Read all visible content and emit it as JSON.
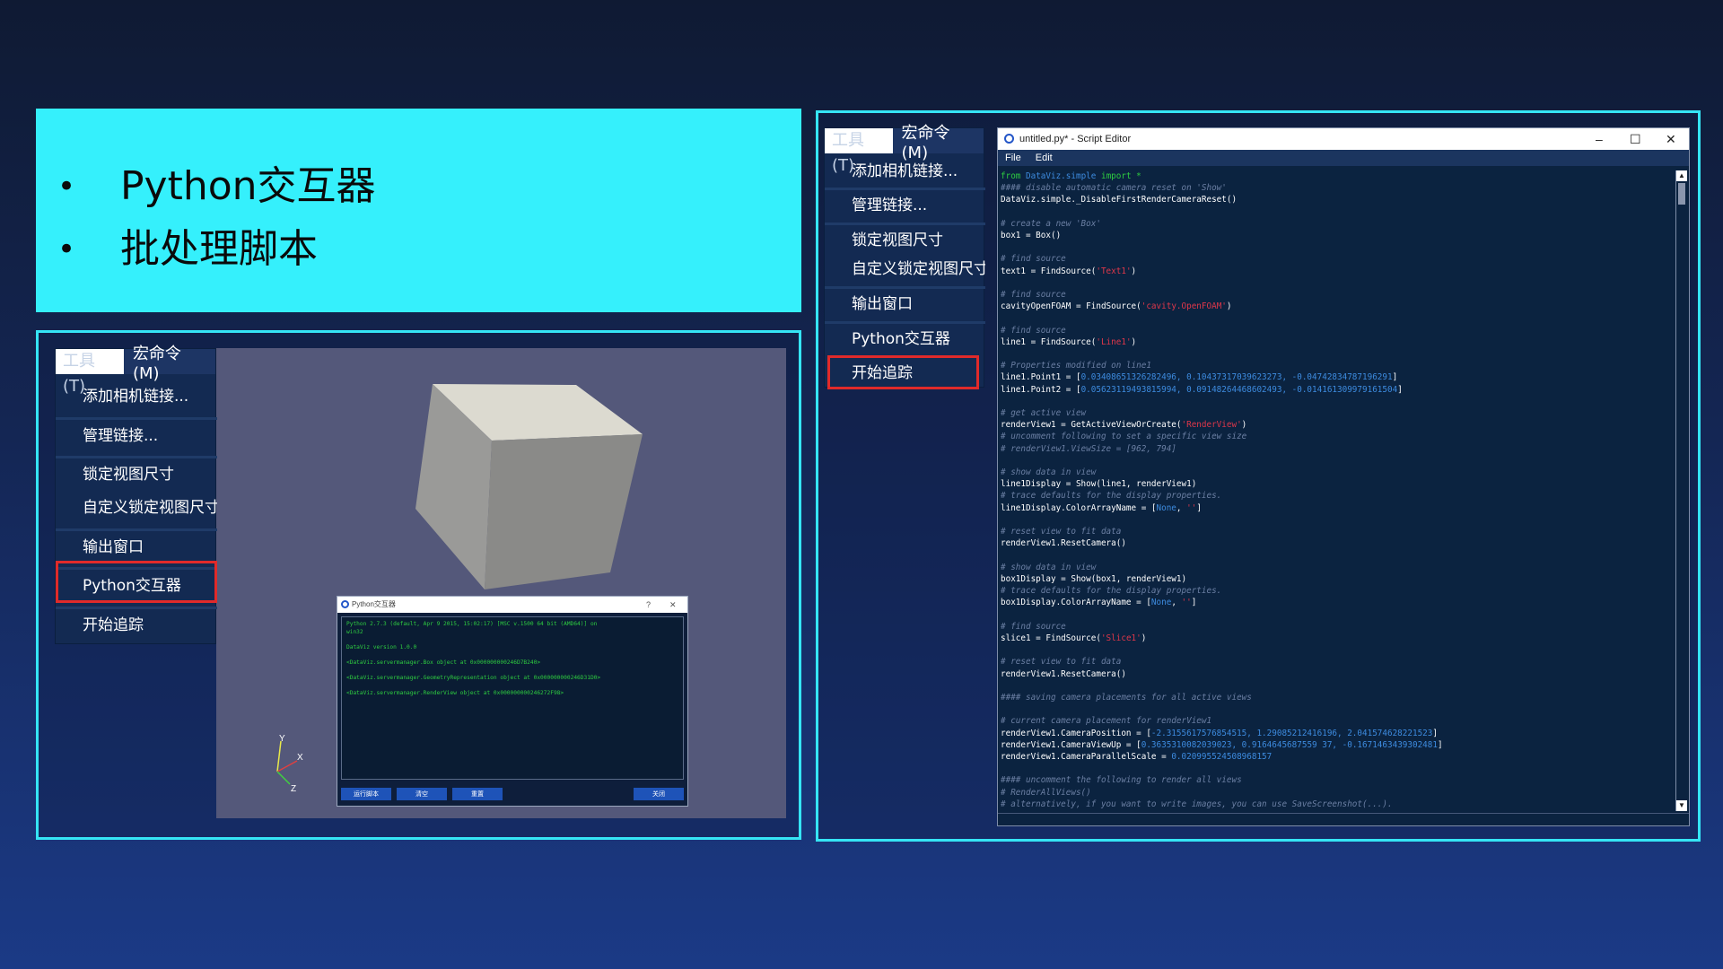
{
  "slide": {
    "bullets": [
      "Python交互器",
      "批处理脚本"
    ]
  },
  "left_menu": {
    "tabs": [
      "工具(T)",
      "宏命令(M)"
    ],
    "items": [
      "添加相机链接...",
      "管理链接...",
      "锁定视图尺寸",
      "自定义锁定视图尺寸",
      "输出窗口",
      "Python交互器",
      "开始追踪"
    ]
  },
  "right_menu": {
    "tabs": [
      "工具(T)",
      "宏命令(M)"
    ],
    "items": [
      "添加相机链接...",
      "管理链接...",
      "锁定视图尺寸",
      "自定义锁定视图尺寸",
      "输出窗口",
      "Python交互器",
      "开始追踪"
    ]
  },
  "axes": {
    "y": "Y",
    "x": "X",
    "z": "Z"
  },
  "python_dialog": {
    "title": "Python交互器",
    "help": "?",
    "close": "✕",
    "console_lines": [
      "Python 2.7.3 (default, Apr  9 2015, 15:02:17) [MSC v.1500 64 bit (AMD64)] on",
      "win32",
      "",
      "DataViz version 1.0.0",
      "",
      "<DataViz.servermanager.Box object at 0x000000000246D7B240>",
      "",
      "<DataViz.servermanager.GeometryRepresentation object at 0x000000000246D31D0>",
      "",
      "<DataViz.servermanager.RenderView object at 0x000000000246272F98>",
      ""
    ],
    "buttons": {
      "run": "运行脚本",
      "clear": "清空",
      "reset": "重置",
      "close": "关闭"
    }
  },
  "editor": {
    "title": "untitled.py* - Script Editor",
    "menu": [
      "File",
      "Edit"
    ],
    "window_controls": [
      "–",
      "☐",
      "✕"
    ],
    "code_lines": [
      [
        [
          "kw",
          "from "
        ],
        [
          "n",
          "DataViz.simple"
        ],
        [
          "kw",
          " import *"
        ]
      ],
      [
        [
          "c",
          "#### disable automatic camera reset on 'Show'"
        ]
      ],
      [
        [
          "t",
          "DataViz.simple._DisableFirstRenderCameraReset()"
        ]
      ],
      [
        [
          "t",
          ""
        ]
      ],
      [
        [
          "c",
          "# create a new 'Box'"
        ]
      ],
      [
        [
          "t",
          "box1 = Box()"
        ]
      ],
      [
        [
          "t",
          ""
        ]
      ],
      [
        [
          "c",
          "# find source"
        ]
      ],
      [
        [
          "t",
          "text1 = FindSource("
        ],
        [
          "s",
          "'Text1'"
        ],
        [
          "t",
          ")"
        ]
      ],
      [
        [
          "t",
          ""
        ]
      ],
      [
        [
          "c",
          "# find source"
        ]
      ],
      [
        [
          "t",
          "cavityOpenFOAM = FindSource("
        ],
        [
          "s",
          "'cavity.OpenFOAM'"
        ],
        [
          "t",
          ")"
        ]
      ],
      [
        [
          "t",
          ""
        ]
      ],
      [
        [
          "c",
          "# find source"
        ]
      ],
      [
        [
          "t",
          "line1 = FindSource("
        ],
        [
          "s",
          "'Line1'"
        ],
        [
          "t",
          ")"
        ]
      ],
      [
        [
          "t",
          ""
        ]
      ],
      [
        [
          "c",
          "# Properties modified on line1"
        ]
      ],
      [
        [
          "t",
          "line1.Point1 = ["
        ],
        [
          "n",
          "0.03408651326282496, 0.10437317039623273, -0.04742834787196291"
        ],
        [
          "t",
          "]"
        ]
      ],
      [
        [
          "t",
          "line1.Point2 = ["
        ],
        [
          "n",
          "0.05623119493815994, 0.09148264468602493, -0.014161309979161504"
        ],
        [
          "t",
          "]"
        ]
      ],
      [
        [
          "t",
          ""
        ]
      ],
      [
        [
          "c",
          "# get active view"
        ]
      ],
      [
        [
          "t",
          "renderView1 = GetActiveViewOrCreate("
        ],
        [
          "s",
          "'RenderView'"
        ],
        [
          "t",
          ")"
        ]
      ],
      [
        [
          "c",
          "# uncomment following to set a specific view size"
        ]
      ],
      [
        [
          "c",
          "# renderView1.ViewSize = [962, 794]"
        ]
      ],
      [
        [
          "t",
          ""
        ]
      ],
      [
        [
          "c",
          "# show data in view"
        ]
      ],
      [
        [
          "t",
          "line1Display = Show(line1, renderView1)"
        ]
      ],
      [
        [
          "c",
          "# trace defaults for the display properties."
        ]
      ],
      [
        [
          "t",
          "line1Display.ColorArrayName = ["
        ],
        [
          "n",
          "None"
        ],
        [
          "t",
          ", "
        ],
        [
          "s",
          "''"
        ],
        [
          "t",
          "]"
        ]
      ],
      [
        [
          "t",
          ""
        ]
      ],
      [
        [
          "c",
          "# reset view to fit data"
        ]
      ],
      [
        [
          "t",
          "renderView1.ResetCamera()"
        ]
      ],
      [
        [
          "t",
          ""
        ]
      ],
      [
        [
          "c",
          "# show data in view"
        ]
      ],
      [
        [
          "t",
          "box1Display = Show(box1, renderView1)"
        ]
      ],
      [
        [
          "c",
          "# trace defaults for the display properties."
        ]
      ],
      [
        [
          "t",
          "box1Display.ColorArrayName = ["
        ],
        [
          "n",
          "None"
        ],
        [
          "t",
          ", "
        ],
        [
          "s",
          "''"
        ],
        [
          "t",
          "]"
        ]
      ],
      [
        [
          "t",
          ""
        ]
      ],
      [
        [
          "c",
          "# find source"
        ]
      ],
      [
        [
          "t",
          "slice1 = FindSource("
        ],
        [
          "s",
          "'Slice1'"
        ],
        [
          "t",
          ")"
        ]
      ],
      [
        [
          "t",
          ""
        ]
      ],
      [
        [
          "c",
          "# reset view to fit data"
        ]
      ],
      [
        [
          "t",
          "renderView1.ResetCamera()"
        ]
      ],
      [
        [
          "t",
          ""
        ]
      ],
      [
        [
          "c",
          "#### saving camera placements for all active views"
        ]
      ],
      [
        [
          "t",
          ""
        ]
      ],
      [
        [
          "c",
          "# current camera placement for renderView1"
        ]
      ],
      [
        [
          "t",
          "renderView1.CameraPosition = ["
        ],
        [
          "n",
          "-2.3155617576854515, 1.29085212416196, 2.041574628221523"
        ],
        [
          "t",
          "]"
        ]
      ],
      [
        [
          "t",
          "renderView1.CameraViewUp = ["
        ],
        [
          "n",
          "0.3635310082039023, 0.9164645687559 37, -0.1671463439302481"
        ],
        [
          "t",
          "]"
        ]
      ],
      [
        [
          "t",
          "renderView1.CameraParallelScale = "
        ],
        [
          "n",
          "0.020995524508968157"
        ]
      ],
      [
        [
          "t",
          ""
        ]
      ],
      [
        [
          "c",
          "#### uncomment the following to render all views"
        ]
      ],
      [
        [
          "c",
          "# RenderAllViews()"
        ]
      ],
      [
        [
          "c",
          "# alternatively, if you want to write images, you can use SaveScreenshot(...)."
        ]
      ]
    ]
  },
  "colors": {
    "accent_cyan": "#35f0fc",
    "highlight_red": "#e02a2a",
    "menu_bg": "#132a52",
    "editor_bg": "#0b2340",
    "console_green": "#2ecc40"
  }
}
